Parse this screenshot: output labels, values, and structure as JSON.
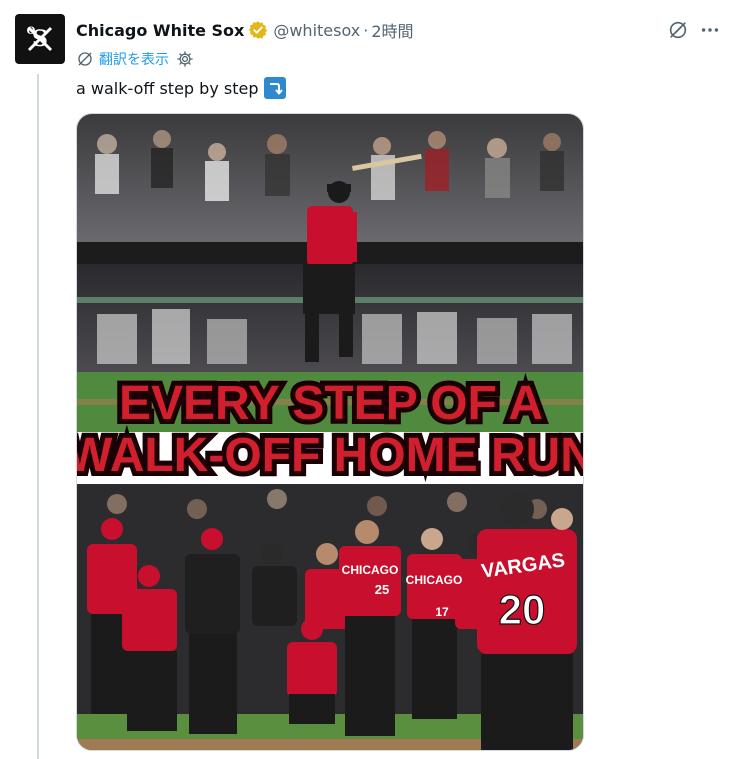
{
  "tweet": {
    "display_name": "Chicago White Sox",
    "handle": "@whitesox",
    "separator": "·",
    "timestamp": "2時間",
    "translate_label": "翻訳を表示",
    "text": "a walk-off step by step",
    "emoji": "arrow-right-curving-down-emoji"
  },
  "media": {
    "headline_line1": "EVERY STEP OF A",
    "headline_line2": "WALK-OFF HOME RUN",
    "jersey_back_name": "VARGAS",
    "jersey_back_number": "20",
    "jersey_front_text": "CHICAGO",
    "jersey_number_25": "25",
    "jersey_number_17": "17"
  },
  "colors": {
    "brand_blue": "#1d9bf0",
    "verified_gold": "#e2b719",
    "secondary_text": "#536471",
    "jersey_red": "#c8102e"
  },
  "icons": {
    "avatar": "white-sox-logo",
    "verified": "verified-badge-icon",
    "grok": "grok-icon",
    "more": "more-icon",
    "translate": "translate-icon",
    "settings": "gear-icon"
  }
}
